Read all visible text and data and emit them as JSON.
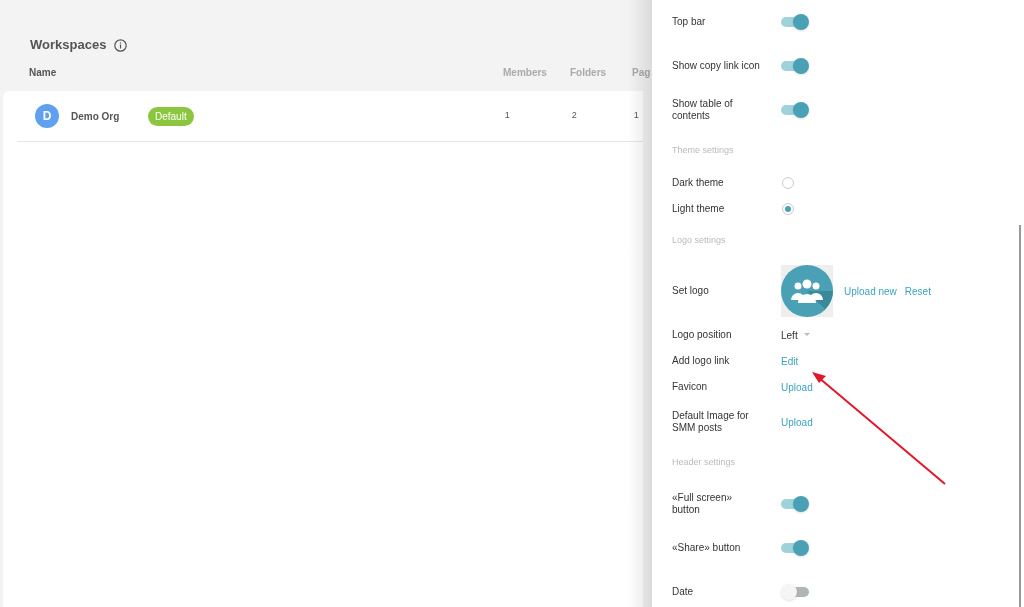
{
  "workspaces": {
    "title": "Workspaces",
    "columns": [
      "Name",
      "Members",
      "Folders",
      "Pag"
    ],
    "rows": [
      {
        "initial": "D",
        "name": "Demo Org",
        "badge": "Default",
        "members": "1",
        "folders": "2",
        "pages": "1"
      }
    ]
  },
  "settings": [
    {
      "kind": "toggle",
      "label": "Top bar",
      "on": true
    },
    {
      "kind": "toggle",
      "label": "Show copy link icon",
      "on": true
    },
    {
      "kind": "toggle",
      "label": "Show table of contents",
      "on": true
    },
    {
      "kind": "section",
      "label": "Theme settings"
    },
    {
      "kind": "radio",
      "label": "Dark theme",
      "selected": false
    },
    {
      "kind": "radio",
      "label": "Light theme",
      "selected": true
    },
    {
      "kind": "section",
      "label": "Logo settings"
    },
    {
      "kind": "logo",
      "label": "Set logo",
      "links": [
        "Upload new",
        "Reset"
      ]
    },
    {
      "kind": "select",
      "label": "Logo position",
      "value": "Left"
    },
    {
      "kind": "link",
      "label": "Add logo link",
      "links": [
        "Edit"
      ]
    },
    {
      "kind": "link",
      "label": "Favicon",
      "links": [
        "Upload"
      ]
    },
    {
      "kind": "link",
      "label": "Default Image for SMM posts",
      "links": [
        "Upload"
      ]
    },
    {
      "kind": "section",
      "label": "Header settings"
    },
    {
      "kind": "toggle",
      "label": "«Full screen» button",
      "on": true
    },
    {
      "kind": "toggle",
      "label": "«Share» button",
      "on": true
    },
    {
      "kind": "toggle",
      "label": "Date",
      "on": false
    }
  ]
}
